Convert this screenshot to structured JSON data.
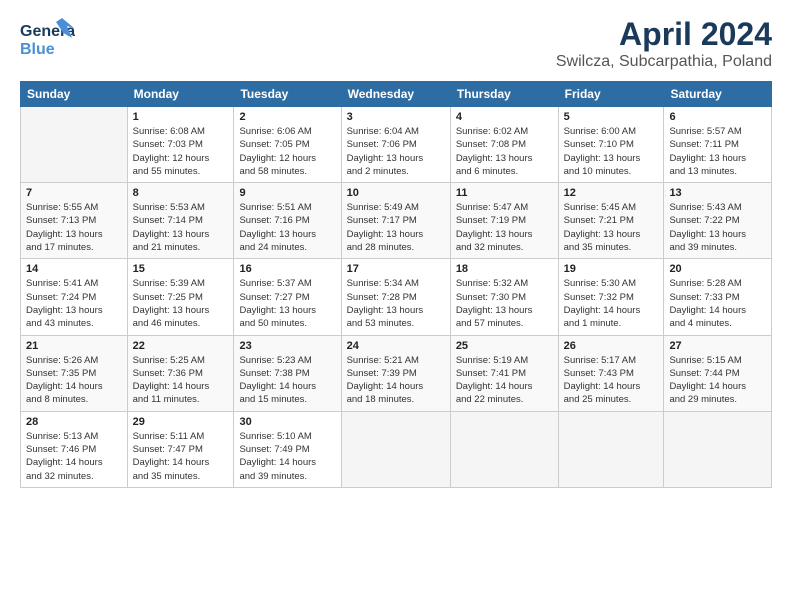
{
  "header": {
    "logo_line1": "General",
    "logo_line2": "Blue",
    "title": "April 2024",
    "subtitle": "Swilcza, Subcarpathia, Poland"
  },
  "days_of_week": [
    "Sunday",
    "Monday",
    "Tuesday",
    "Wednesday",
    "Thursday",
    "Friday",
    "Saturday"
  ],
  "weeks": [
    [
      {
        "day": "",
        "info": ""
      },
      {
        "day": "1",
        "info": "Sunrise: 6:08 AM\nSunset: 7:03 PM\nDaylight: 12 hours\nand 55 minutes."
      },
      {
        "day": "2",
        "info": "Sunrise: 6:06 AM\nSunset: 7:05 PM\nDaylight: 12 hours\nand 58 minutes."
      },
      {
        "day": "3",
        "info": "Sunrise: 6:04 AM\nSunset: 7:06 PM\nDaylight: 13 hours\nand 2 minutes."
      },
      {
        "day": "4",
        "info": "Sunrise: 6:02 AM\nSunset: 7:08 PM\nDaylight: 13 hours\nand 6 minutes."
      },
      {
        "day": "5",
        "info": "Sunrise: 6:00 AM\nSunset: 7:10 PM\nDaylight: 13 hours\nand 10 minutes."
      },
      {
        "day": "6",
        "info": "Sunrise: 5:57 AM\nSunset: 7:11 PM\nDaylight: 13 hours\nand 13 minutes."
      }
    ],
    [
      {
        "day": "7",
        "info": "Sunrise: 5:55 AM\nSunset: 7:13 PM\nDaylight: 13 hours\nand 17 minutes."
      },
      {
        "day": "8",
        "info": "Sunrise: 5:53 AM\nSunset: 7:14 PM\nDaylight: 13 hours\nand 21 minutes."
      },
      {
        "day": "9",
        "info": "Sunrise: 5:51 AM\nSunset: 7:16 PM\nDaylight: 13 hours\nand 24 minutes."
      },
      {
        "day": "10",
        "info": "Sunrise: 5:49 AM\nSunset: 7:17 PM\nDaylight: 13 hours\nand 28 minutes."
      },
      {
        "day": "11",
        "info": "Sunrise: 5:47 AM\nSunset: 7:19 PM\nDaylight: 13 hours\nand 32 minutes."
      },
      {
        "day": "12",
        "info": "Sunrise: 5:45 AM\nSunset: 7:21 PM\nDaylight: 13 hours\nand 35 minutes."
      },
      {
        "day": "13",
        "info": "Sunrise: 5:43 AM\nSunset: 7:22 PM\nDaylight: 13 hours\nand 39 minutes."
      }
    ],
    [
      {
        "day": "14",
        "info": "Sunrise: 5:41 AM\nSunset: 7:24 PM\nDaylight: 13 hours\nand 43 minutes."
      },
      {
        "day": "15",
        "info": "Sunrise: 5:39 AM\nSunset: 7:25 PM\nDaylight: 13 hours\nand 46 minutes."
      },
      {
        "day": "16",
        "info": "Sunrise: 5:37 AM\nSunset: 7:27 PM\nDaylight: 13 hours\nand 50 minutes."
      },
      {
        "day": "17",
        "info": "Sunrise: 5:34 AM\nSunset: 7:28 PM\nDaylight: 13 hours\nand 53 minutes."
      },
      {
        "day": "18",
        "info": "Sunrise: 5:32 AM\nSunset: 7:30 PM\nDaylight: 13 hours\nand 57 minutes."
      },
      {
        "day": "19",
        "info": "Sunrise: 5:30 AM\nSunset: 7:32 PM\nDaylight: 14 hours\nand 1 minute."
      },
      {
        "day": "20",
        "info": "Sunrise: 5:28 AM\nSunset: 7:33 PM\nDaylight: 14 hours\nand 4 minutes."
      }
    ],
    [
      {
        "day": "21",
        "info": "Sunrise: 5:26 AM\nSunset: 7:35 PM\nDaylight: 14 hours\nand 8 minutes."
      },
      {
        "day": "22",
        "info": "Sunrise: 5:25 AM\nSunset: 7:36 PM\nDaylight: 14 hours\nand 11 minutes."
      },
      {
        "day": "23",
        "info": "Sunrise: 5:23 AM\nSunset: 7:38 PM\nDaylight: 14 hours\nand 15 minutes."
      },
      {
        "day": "24",
        "info": "Sunrise: 5:21 AM\nSunset: 7:39 PM\nDaylight: 14 hours\nand 18 minutes."
      },
      {
        "day": "25",
        "info": "Sunrise: 5:19 AM\nSunset: 7:41 PM\nDaylight: 14 hours\nand 22 minutes."
      },
      {
        "day": "26",
        "info": "Sunrise: 5:17 AM\nSunset: 7:43 PM\nDaylight: 14 hours\nand 25 minutes."
      },
      {
        "day": "27",
        "info": "Sunrise: 5:15 AM\nSunset: 7:44 PM\nDaylight: 14 hours\nand 29 minutes."
      }
    ],
    [
      {
        "day": "28",
        "info": "Sunrise: 5:13 AM\nSunset: 7:46 PM\nDaylight: 14 hours\nand 32 minutes."
      },
      {
        "day": "29",
        "info": "Sunrise: 5:11 AM\nSunset: 7:47 PM\nDaylight: 14 hours\nand 35 minutes."
      },
      {
        "day": "30",
        "info": "Sunrise: 5:10 AM\nSunset: 7:49 PM\nDaylight: 14 hours\nand 39 minutes."
      },
      {
        "day": "",
        "info": ""
      },
      {
        "day": "",
        "info": ""
      },
      {
        "day": "",
        "info": ""
      },
      {
        "day": "",
        "info": ""
      }
    ]
  ]
}
